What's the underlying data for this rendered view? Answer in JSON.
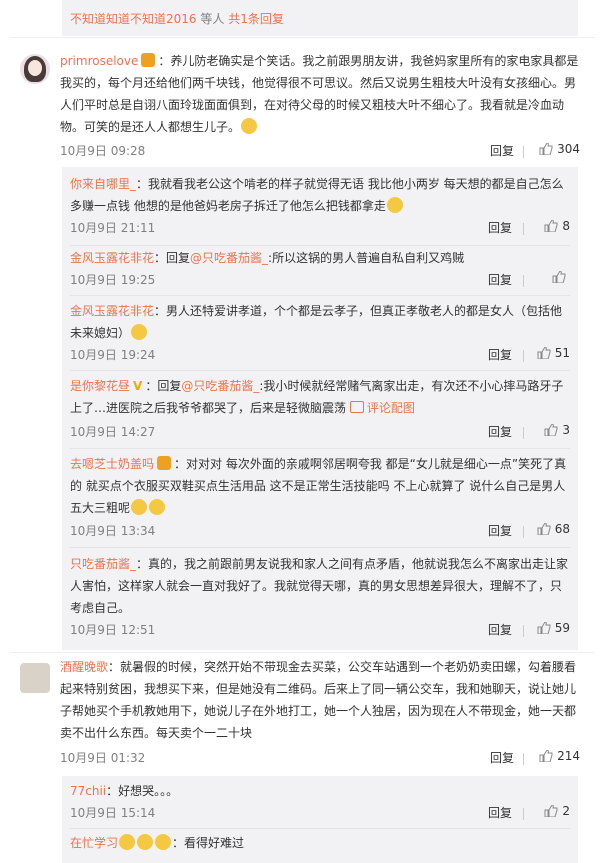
{
  "top": {
    "users": "不知道知道不知道2016",
    "suffix": " 等人 ",
    "count": "共1条回复"
  },
  "icons": {
    "like": "thumb-up-icon"
  },
  "comments": [
    {
      "user": "primroselove",
      "text": "：养儿防老确实是个笑话。我之前跟男朋友讲，我爸妈家里所有的家电家具都是我买的，每个月还给他们两千块钱，他觉得很不可思议。然后又说男生粗枝大叶没有女孩细心。男人们平时总是自诩八面玲珑面面俱到，在对待父母的时候又粗枝大叶不细心了。我看就是冷血动物。可笑的是还人人都想生儿子。",
      "time": "10月9日 09:28",
      "reply": "回复",
      "likes": "304"
    },
    {
      "user": "酒醒晚歌",
      "text": "：就暑假的时候，突然开始不带现金去买菜，公交车站遇到一个老奶奶卖田螺，勾着腰看起来特别贫困，我想买下来，但是她没有二维码。后来上了同一辆公交车，我和她聊天，说让她儿子帮她买个手机教她用下，她说儿子在外地打工，她一个人独居，因为现在人不带现金，她一天都卖不出什么东西。每天卖个一二十块",
      "time": "10月9日 01:32",
      "reply": "回复",
      "likes": "214"
    }
  ],
  "replies": [
    {
      "user": "你来自哪里_",
      "text": "：我就看我老公这个啃老的样子就觉得无语 我比他小两岁 每天想的都是自己怎么多赚一点钱 他想的是他爸妈老房子拆迁了他怎么把钱都拿走",
      "time": "10月9日 21:11",
      "reply": "回复",
      "likes": "8"
    },
    {
      "user": "金风玉露花非花",
      "pre": "：回复",
      "at": "@只吃番茄酱_",
      "text": ":所以这锅的男人普遍自私自利又鸡贼",
      "time": "10月9日 19:25",
      "reply": "回复",
      "likes": ""
    },
    {
      "user": "金风玉露花非花",
      "text": "：男人还特爱讲孝道，个个都是云孝子，但真正孝敬老人的都是女人（包括他未来媳妇）",
      "time": "10月9日 19:24",
      "reply": "回复",
      "likes": "51"
    },
    {
      "user": "是你黎花昼",
      "pre": "：回复",
      "at": "@只吃番茄酱_",
      "text": ":我小时候就经常赌气离家出走，有次还不小心摔马路牙子上了…进医院之后我爷爷都哭了，后来是轻微脑震荡",
      "pic": "评论配图",
      "time": "10月9日 14:27",
      "reply": "回复",
      "likes": "3"
    },
    {
      "user": "去嗯芝士奶盖吗",
      "text": "：对对对 每次外面的亲戚啊邻居啊夸我 都是“女儿就是细心一点”笑死了真的 就买点个衣服买双鞋买点生活用品 这不是正常生活技能吗 不上心就算了 说什么自己是男人五大三粗呢",
      "time": "10月9日 13:34",
      "reply": "回复",
      "likes": "68"
    },
    {
      "user": "只吃番茄酱_",
      "text": "：真的，我之前跟前男友说我和家人之间有点矛盾，他就说我怎么不离家出走让家人害怕，这样家人就会一直对我好了。我就觉得天哪，真的男女思想差异很大，理解不了，只考虑自己。",
      "time": "10月9日 12:51",
      "reply": "回复",
      "likes": "59"
    },
    {
      "user": "77chii",
      "text": "：好想哭。。。",
      "time": "10月9日 15:14",
      "reply": "回复",
      "likes": "2"
    },
    {
      "user": "在忙学习",
      "text": "：看得好难过",
      "time": "",
      "reply": "",
      "likes": ""
    }
  ]
}
